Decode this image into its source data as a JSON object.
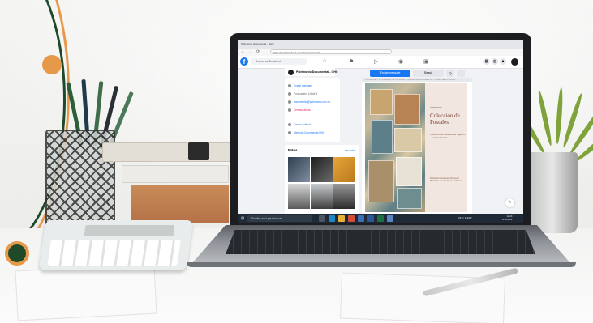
{
  "browser": {
    "tab_title": "Patrimonio Documental - OHC",
    "url": "https://www.facebook.com/ohc.documental",
    "nav_back": "←",
    "nav_forward": "→",
    "nav_reload": "⟳"
  },
  "facebook": {
    "logo": "f",
    "search_placeholder": "Buscar en Facebook",
    "nav_icons": [
      "home-icon",
      "flag-icon",
      "video-icon",
      "marketplace-icon",
      "groups-icon"
    ],
    "right_icons": [
      "menu-grid-icon",
      "messenger-icon",
      "bell-icon"
    ]
  },
  "page": {
    "name": "Patrimonio Documental - OHC",
    "buttons": {
      "message": "Enviar mensaje",
      "follow": "Seguir",
      "search": "Q",
      "more": "..."
    },
    "intro": [
      {
        "icon": "message-icon",
        "text": "Enviar mensaje"
      },
      {
        "icon": "star-icon",
        "text": "Puntuación: 4,5 de 5"
      },
      {
        "icon": "email-icon",
        "text": "documental@patrimonio.ohc.cu"
      },
      {
        "icon": "clock-icon",
        "text": "Cerrado ahora"
      },
      {
        "icon": "tag-icon",
        "text": "Centro cultural"
      },
      {
        "icon": "web-icon",
        "text": "Memoria Documental OHC"
      }
    ]
  },
  "photos": {
    "title": "Fotos",
    "link": "Ver todas",
    "thumbs": [
      "#4b5f73",
      "#3a3a3a",
      "#e0a234",
      "#2c2c2c",
      "#b8bcbf",
      "#6b6b6b"
    ]
  },
  "post": {
    "strip_text": "OFICINA DEL HISTORIADOR DE LA CIUDAD · PATRIMONIO DOCUMENTAL · FONDO DE POSTALES",
    "eyebrow": "PATRIMONIO",
    "title": "Colección de Postales",
    "subtitle": "Colección de Postales del Siglo XX · Archivo Histórico",
    "footer": "Patrimonio Documental Oficina del Historiador de la Ciudad de La Habana"
  },
  "taskbar": {
    "start": "⊞",
    "search_placeholder": "Escribe aquí para buscar",
    "tray": "21°C  ∧  ESP",
    "time": "12:24",
    "date": "2/12/2022"
  },
  "colors": {
    "facebook_blue": "#1877f2",
    "deco_green": "#1f4a2a",
    "deco_orange": "#e7994a",
    "taskbar": "#1f2a36"
  }
}
